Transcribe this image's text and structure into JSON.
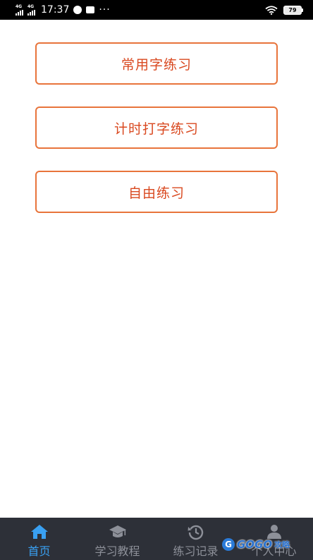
{
  "status_bar": {
    "network_1": "4G",
    "network_2": "4G",
    "time": "17:37",
    "more": "···",
    "battery": "79"
  },
  "main": {
    "buttons": [
      {
        "label": "常用字练习"
      },
      {
        "label": "计时打字练习"
      },
      {
        "label": "自由练习"
      }
    ]
  },
  "tab_bar": {
    "tabs": [
      {
        "label": "首页",
        "icon": "home-icon",
        "active": true
      },
      {
        "label": "学习教程",
        "icon": "graduation-cap-icon",
        "active": false
      },
      {
        "label": "练习记录",
        "icon": "history-icon",
        "active": false
      },
      {
        "label": "个人中心",
        "icon": "user-icon",
        "active": false
      }
    ]
  },
  "watermark": {
    "logo": "G",
    "text": "GOGO",
    "sub": "攻略"
  },
  "colors": {
    "accent": "#e8743b",
    "button_text": "#d9481f",
    "tab_active": "#39a0f2",
    "tab_inactive": "#8d9099",
    "tab_bar_bg": "#2d3038"
  }
}
